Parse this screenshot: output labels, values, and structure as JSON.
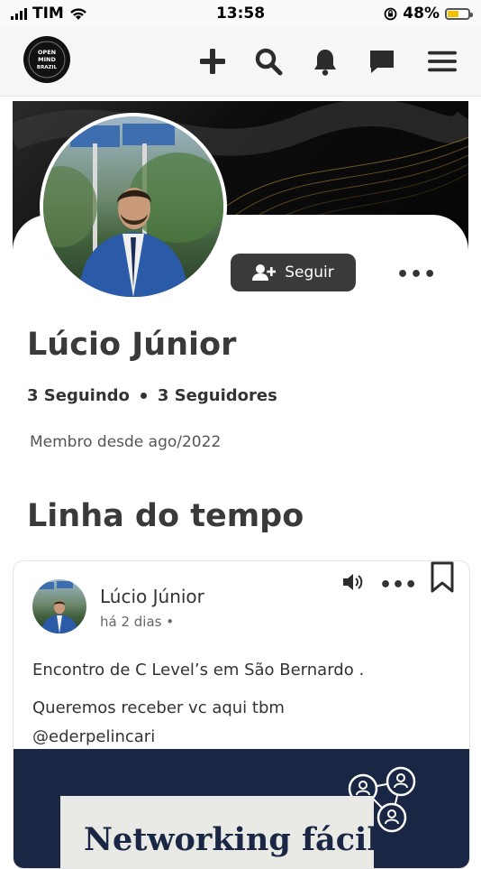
{
  "status_bar": {
    "carrier": "TIM",
    "time": "13:58",
    "battery_percent": "48%",
    "battery_level": 0.48,
    "battery_color": "#f2c200"
  },
  "nav": {
    "logo_text": "OPEN MIND BRAZIL",
    "icons": [
      "plus-icon",
      "search-icon",
      "bell-icon",
      "chat-icon",
      "menu-icon"
    ]
  },
  "profile": {
    "follow_label": "Seguir",
    "name": "Lúcio Júnior",
    "following": "3 Seguindo",
    "followers": "3 Seguidores",
    "member_since": "Membro desde ago/2022"
  },
  "timeline": {
    "title": "Linha do tempo"
  },
  "post": {
    "author": "Lúcio Júnior",
    "date": "há 2 dias •",
    "text_line1": "Encontro de C Level’s em São Bernardo .",
    "text_line2": "Queremos receber vc aqui tbm",
    "text_line3": "@ederpelincari",
    "image_title": "Networking fácil,"
  },
  "colors": {
    "button_dark": "#3a3a3a",
    "image_navy": "#1a2744"
  }
}
